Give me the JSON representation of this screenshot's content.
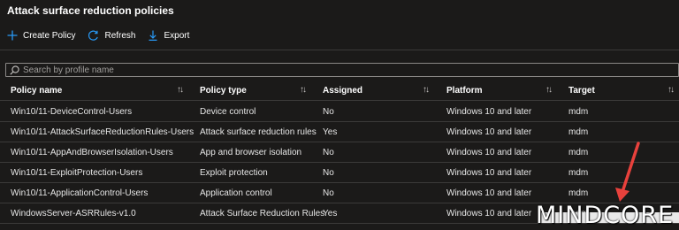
{
  "page": {
    "title": "Attack surface reduction policies"
  },
  "toolbar": {
    "create_label": "Create Policy",
    "refresh_label": "Refresh",
    "export_label": "Export"
  },
  "search": {
    "placeholder": "Search by profile name",
    "value": ""
  },
  "table": {
    "columns": [
      "Policy name",
      "Policy type",
      "Assigned",
      "Platform",
      "Target"
    ],
    "rows": [
      [
        "Win10/11-DeviceControl-Users",
        "Device control",
        "No",
        "Windows 10 and later",
        "mdm"
      ],
      [
        "Win10/11-AttackSurfaceReductionRules-Users",
        "Attack surface reduction rules",
        "Yes",
        "Windows 10 and later",
        "mdm"
      ],
      [
        "Win10/11-AppAndBrowserIsolation-Users",
        "App and browser isolation",
        "No",
        "Windows 10 and later",
        "mdm"
      ],
      [
        "Win10/11-ExploitProtection-Users",
        "Exploit protection",
        "No",
        "Windows 10 and later",
        "mdm"
      ],
      [
        "Win10/11-ApplicationControl-Users",
        "Application control",
        "No",
        "Windows 10 and later",
        "mdm"
      ],
      [
        "WindowsServer-ASRRules-v1.0",
        "Attack Surface Reduction Rules",
        "Yes",
        "Windows 10 and later",
        "mdm"
      ]
    ]
  },
  "watermark": {
    "text": "MINDCORE"
  },
  "icons": {
    "create": "plus-icon",
    "refresh": "refresh-icon",
    "export": "download-icon",
    "search": "search-icon",
    "sort": "sort-arrows-icon"
  },
  "colors": {
    "background": "#1b1a19",
    "accent": "#2899f5",
    "annotation_arrow": "#e8413c",
    "border": "#3b3a39"
  }
}
